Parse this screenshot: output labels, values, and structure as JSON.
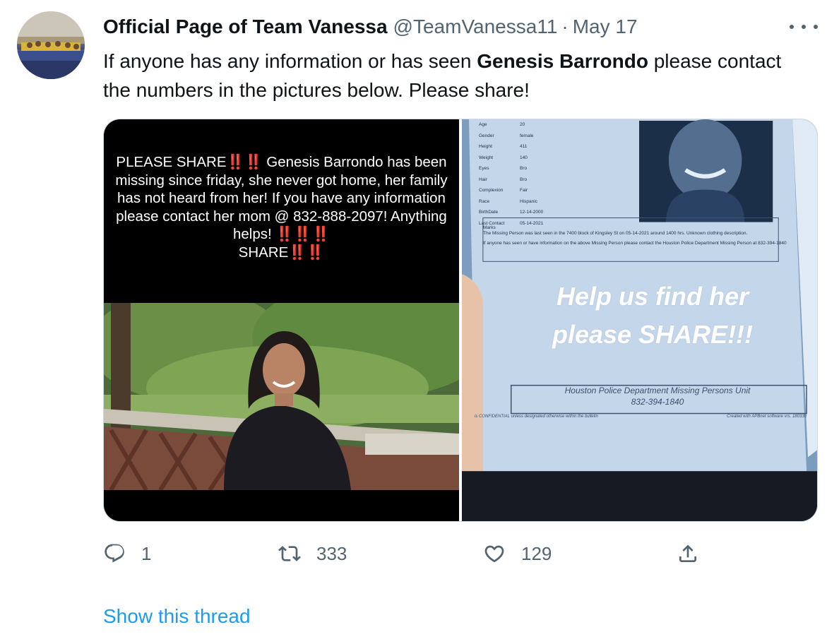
{
  "tweet": {
    "author_name": "Official Page of Team Vanessa",
    "handle": "@TeamVanessa11",
    "separator": "·",
    "date": "May 17",
    "text_before": "If anyone has any information or has seen ",
    "text_bold": "Genesis Barrondo",
    "text_after": " please contact the numbers in the pictures below. Please share!"
  },
  "media": {
    "left_image": {
      "line1_a": "PLEASE SHARE",
      "bangs": "‼️‼️",
      "line1_b": " Genesis Barrondo has been missing since friday, she never got home, her family has not heard from her! If you have any information please contact her mom @ 832-888-2097! Anything helps! ",
      "bangs_mid": "‼️‼️‼️",
      "line_end": "SHARE",
      "bangs_end": "‼️‼️"
    },
    "right_image": {
      "fields": [
        {
          "k": "Age",
          "v": "20"
        },
        {
          "k": "Gender",
          "v": "female"
        },
        {
          "k": "Height",
          "v": "411"
        },
        {
          "k": "Weight",
          "v": "140"
        },
        {
          "k": "Eyes",
          "v": "Bro"
        },
        {
          "k": "Hair",
          "v": "Bro"
        },
        {
          "k": "Complexion",
          "v": "Fair"
        },
        {
          "k": "Race",
          "v": "Hispanic"
        },
        {
          "k": "BirthDate",
          "v": "12-14-2000"
        },
        {
          "k": "Last Contact",
          "v": "05-14-2021"
        }
      ],
      "marks_label": "Marks",
      "marks_text": "The Missing Person was last seen in the 7400 block of Kingsley St on 05-14-2021 around 1400 hrs. Unknown clothing description.",
      "contact_text": "If anyone has seen or have information on the above Missing Person please contact the Houston Police Department Missing Person at 832-394-1840",
      "overlay_line1": "Help us find her",
      "overlay_line2": "please SHARE!!!",
      "unit_name": "Houston Police Department Missing Persons Unit",
      "unit_phone": "832-394-1840",
      "note_left": "is CONFIDENTIAL unless designated otherwise within the bulletin",
      "note_right": "Created with APBnet software vrs. 180330"
    }
  },
  "actions": {
    "reply_count": "1",
    "retweet_count": "333",
    "like_count": "129"
  },
  "show_thread_label": "Show this thread",
  "colors": {
    "link": "#1d9bf0",
    "secondary_text": "#536471",
    "primary_text": "#0f1419"
  },
  "icons": {
    "reply": "reply-icon",
    "retweet": "retweet-icon",
    "like": "heart-icon",
    "share": "share-icon",
    "more": "more-icon"
  }
}
